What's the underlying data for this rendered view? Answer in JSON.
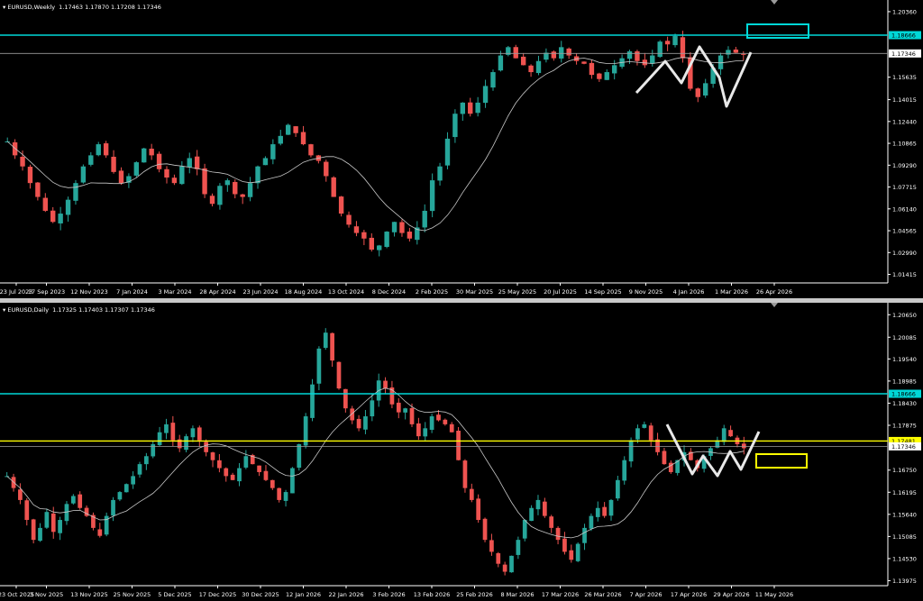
{
  "panels": [
    {
      "symbol": "EURUSD,Weekly",
      "ohlc": "1.17463 1.17870 1.17208 1.17346",
      "price_labels": [
        "1.20360",
        "1.17346",
        "1.15635",
        "1.14015",
        "1.12440",
        "1.10865",
        "1.09290",
        "1.07715",
        "1.06140",
        "1.04565",
        "1.02990",
        "1.01415"
      ],
      "time_labels": [
        "23 Jul 2023",
        "17 Sep 2023",
        "12 Nov 2023",
        "7 Jan 2024",
        "3 Mar 2024",
        "28 Apr 2024",
        "23 Jun 2024",
        "18 Aug 2024",
        "13 Oct 2024",
        "8 Dec 2024",
        "2 Feb 2025",
        "30 Mar 2025",
        "25 May 2025",
        "20 Jul 2025",
        "14 Sep 2025",
        "9 Nov 2025",
        "4 Jan 2026",
        "1 Mar 2026",
        "26 Apr 2026"
      ],
      "hline_cyan": "1.18666",
      "current_price": "1.17346"
    },
    {
      "symbol": "EURUSD,Daily",
      "ohlc": "1.17325 1.17403 1.17307 1.17346",
      "price_labels": [
        "1.20650",
        "1.20085",
        "1.19540",
        "1.18985",
        "1.18430",
        "1.17875",
        "1.16750",
        "1.16195",
        "1.15640",
        "1.15085",
        "1.14530",
        "1.13975"
      ],
      "time_labels": [
        "23 Oct 2025",
        "3 Nov 2025",
        "13 Nov 2025",
        "25 Nov 2025",
        "5 Dec 2025",
        "17 Dec 2025",
        "30 Dec 2025",
        "12 Jan 2026",
        "22 Jan 2026",
        "3 Feb 2026",
        "13 Feb 2026",
        "25 Feb 2026",
        "8 Mar 2026",
        "17 Mar 2026",
        "26 Mar 2026",
        "7 Apr 2026",
        "17 Apr 2026",
        "29 Apr 2026",
        "11 May 2026"
      ],
      "hline_cyan": "1.18666",
      "hline_yellow": "1.17481",
      "current_price": "1.17346"
    }
  ],
  "colors": {
    "bull": "#26a69a",
    "bear": "#ef5350",
    "ma": "#c8c8c8",
    "cyan": "#00d8d8",
    "yellow": "#ffff00",
    "axis": "#ffffff"
  },
  "chart_data": [
    {
      "type": "candlestick",
      "title": "EURUSD,Weekly",
      "ylim": [
        1.008,
        1.212
      ],
      "y_ticks": [
        1.2036,
        1.17346,
        1.15635,
        1.14015,
        1.1244,
        1.10865,
        1.0929,
        1.07715,
        1.0614,
        1.04565,
        1.0299,
        1.01415
      ],
      "x_tick_labels": [
        "23 Jul 2023",
        "17 Sep 2023",
        "12 Nov 2023",
        "7 Jan 2024",
        "3 Mar 2024",
        "28 Apr 2024",
        "23 Jun 2024",
        "18 Aug 2024",
        "13 Oct 2024",
        "8 Dec 2024",
        "2 Feb 2025",
        "30 Mar 2025",
        "25 May 2025",
        "20 Jul 2025",
        "14 Sep 2025",
        "9 Nov 2025",
        "4 Jan 2026",
        "1 Mar 2026",
        "26 Apr 2026"
      ],
      "hlines": [
        1.18666,
        1.17346
      ],
      "close_path": [
        1.11,
        1.1,
        1.092,
        1.08,
        1.07,
        1.06,
        1.052,
        1.058,
        1.068,
        1.08,
        1.092,
        1.1,
        1.108,
        1.1,
        1.088,
        1.08,
        1.085,
        1.095,
        1.105,
        1.1,
        1.09,
        1.084,
        1.08,
        1.092,
        1.098,
        1.09,
        1.072,
        1.065,
        1.078,
        1.082,
        1.072,
        1.07,
        1.08,
        1.092,
        1.098,
        1.108,
        1.114,
        1.122,
        1.116,
        1.108,
        1.1,
        1.096,
        1.085,
        1.07,
        1.058,
        1.05,
        1.044,
        1.04,
        1.032,
        1.035,
        1.045,
        1.052,
        1.044,
        1.04,
        1.048,
        1.06,
        1.082,
        1.092,
        1.112,
        1.13,
        1.138,
        1.13,
        1.138,
        1.15,
        1.16,
        1.172,
        1.178,
        1.17,
        1.165,
        1.16,
        1.168,
        1.174,
        1.17,
        1.178,
        1.172,
        1.168,
        1.166,
        1.158,
        1.155,
        1.16,
        1.165,
        1.17,
        1.175,
        1.168,
        1.165,
        1.172,
        1.182,
        1.18,
        1.186,
        1.17,
        1.148,
        1.142,
        1.152,
        1.163,
        1.172,
        1.176,
        1.174,
        1.173
      ]
    },
    {
      "type": "candlestick",
      "title": "EURUSD,Daily",
      "ylim": [
        1.1385,
        1.2095
      ],
      "y_ticks": [
        1.2065,
        1.20085,
        1.1954,
        1.18985,
        1.1843,
        1.17875,
        1.1675,
        1.16195,
        1.1564,
        1.15085,
        1.1453,
        1.13975
      ],
      "x_tick_labels": [
        "23 Oct 2025",
        "3 Nov 2025",
        "13 Nov 2025",
        "25 Nov 2025",
        "5 Dec 2025",
        "17 Dec 2025",
        "30 Dec 2025",
        "12 Jan 2026",
        "22 Jan 2026",
        "3 Feb 2026",
        "13 Feb 2026",
        "25 Feb 2026",
        "8 Mar 2026",
        "17 Mar 2026",
        "26 Mar 2026",
        "7 Apr 2026",
        "17 Apr 2026",
        "29 Apr 2026",
        "11 May 2026"
      ],
      "hlines": [
        1.18666,
        1.17481,
        1.17346
      ],
      "close_path": [
        1.166,
        1.163,
        1.16,
        1.155,
        1.15,
        1.153,
        1.157,
        1.152,
        1.155,
        1.159,
        1.161,
        1.158,
        1.156,
        1.153,
        1.151,
        1.156,
        1.16,
        1.162,
        1.164,
        1.166,
        1.169,
        1.171,
        1.174,
        1.177,
        1.179,
        1.175,
        1.173,
        1.176,
        1.178,
        1.175,
        1.172,
        1.17,
        1.168,
        1.166,
        1.165,
        1.168,
        1.171,
        1.169,
        1.167,
        1.165,
        1.163,
        1.16,
        1.162,
        1.168,
        1.174,
        1.181,
        1.189,
        1.198,
        1.202,
        1.195,
        1.188,
        1.183,
        1.18,
        1.178,
        1.181,
        1.185,
        1.19,
        1.188,
        1.184,
        1.182,
        1.183,
        1.179,
        1.176,
        1.178,
        1.181,
        1.18,
        1.179,
        1.177,
        1.17,
        1.163,
        1.16,
        1.155,
        1.15,
        1.147,
        1.144,
        1.142,
        1.146,
        1.15,
        1.155,
        1.158,
        1.16,
        1.156,
        1.153,
        1.15,
        1.147,
        1.145,
        1.149,
        1.153,
        1.156,
        1.158,
        1.156,
        1.16,
        1.165,
        1.17,
        1.175,
        1.178,
        1.179,
        1.175,
        1.172,
        1.169,
        1.167,
        1.17,
        1.172,
        1.17,
        1.168,
        1.171,
        1.173,
        1.175,
        1.178,
        1.176,
        1.174,
        1.173
      ]
    }
  ]
}
